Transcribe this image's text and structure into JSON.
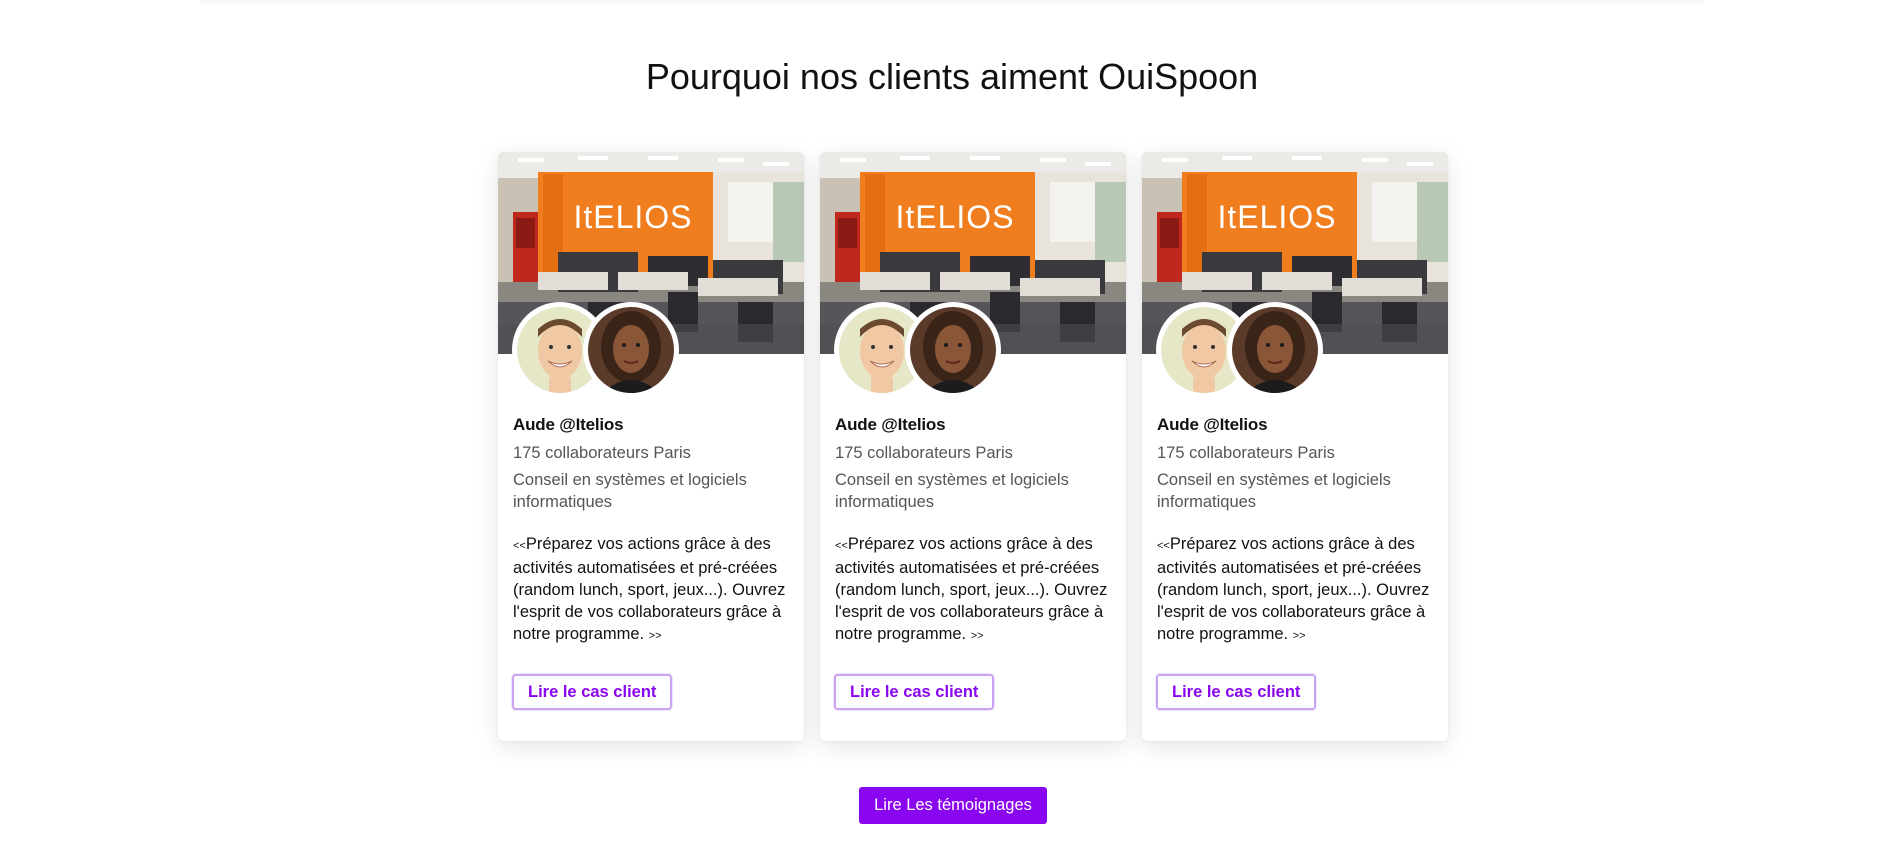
{
  "section": {
    "title": "Pourquoi nos clients aiment OuiSpoon"
  },
  "cards": [
    {
      "photo_text": "ItELIOS",
      "name": "Aude @Itelios",
      "employees": "175 collaborateurs Paris",
      "sector": "Conseil en systèmes et logiciels informatiques",
      "open_quote": "<<",
      "quote": "Préparez vos actions grâce à des activités automatisées et pré-créées (random lunch, sport, jeux...). Ouvrez l'esprit de vos collaborateurs grâce à notre programme.",
      "close_quote": ">>",
      "button_label": "Lire le cas client"
    },
    {
      "photo_text": "ItELIOS",
      "name": "Aude @Itelios",
      "employees": "175 collaborateurs Paris",
      "sector": "Conseil en systèmes et logiciels informatiques",
      "open_quote": "<<",
      "quote": "Préparez vos actions grâce à des activités automatisées et pré-créées (random lunch, sport, jeux...). Ouvrez l'esprit de vos collaborateurs grâce à notre programme.",
      "close_quote": ">>",
      "button_label": "Lire le cas client"
    },
    {
      "photo_text": "ItELIOS",
      "name": "Aude @Itelios",
      "employees": "175 collaborateurs Paris",
      "sector": "Conseil en systèmes et logiciels informatiques",
      "open_quote": "<<",
      "quote": "Préparez vos actions grâce à des activités automatisées et pré-créées (random lunch, sport, jeux...). Ouvrez l'esprit de vos collaborateurs grâce à notre programme.",
      "close_quote": ">>",
      "button_label": "Lire le cas client"
    }
  ],
  "cta": {
    "label": "Lire Les témoignages"
  },
  "colors": {
    "accent": "#8a05f0",
    "office_wall": "#f07d1e"
  }
}
